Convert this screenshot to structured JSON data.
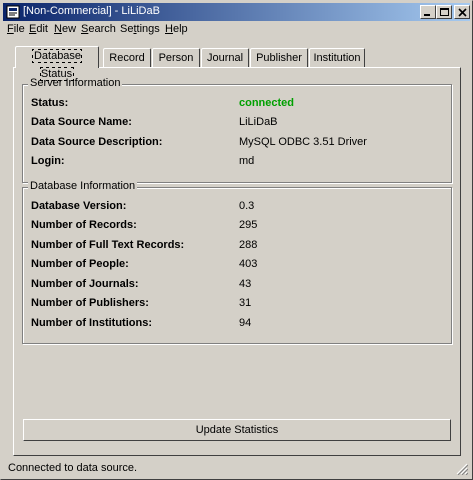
{
  "window": {
    "title": "[Non-Commercial] - LiLiDaB"
  },
  "menu": [
    "File",
    "Edit",
    "New",
    "Search",
    "Settings",
    "Help"
  ],
  "menu_underline": [
    "F",
    "E",
    "N",
    "S",
    "t",
    "H"
  ],
  "tabs": [
    {
      "label": "Database Status",
      "active": true
    },
    {
      "label": "Record",
      "active": false
    },
    {
      "label": "Person",
      "active": false
    },
    {
      "label": "Journal",
      "active": false
    },
    {
      "label": "Publisher",
      "active": false
    },
    {
      "label": "Institution",
      "active": false
    }
  ],
  "server_info": {
    "legend": "Server Information",
    "rows": [
      {
        "label": "Status:",
        "value": "connected"
      },
      {
        "label": "Data Source Name:",
        "value": "LiLiDaB"
      },
      {
        "label": "Data Source Description:",
        "value": "MySQL ODBC 3.51 Driver"
      },
      {
        "label": "Login:",
        "value": "md"
      }
    ]
  },
  "db_info": {
    "legend": "Database Information",
    "rows": [
      {
        "label": "Database Version:",
        "value": "0.3"
      },
      {
        "label": "Number of Records:",
        "value": "295"
      },
      {
        "label": "Number of Full Text Records:",
        "value": "288"
      },
      {
        "label": "Number of People:",
        "value": "403"
      },
      {
        "label": "Number of Journals:",
        "value": "43"
      },
      {
        "label": "Number of Publishers:",
        "value": "31"
      },
      {
        "label": "Number of Institutions:",
        "value": "94"
      }
    ]
  },
  "update_button": "Update Statistics",
  "status_bar": "Connected to data source.",
  "colors": {
    "title_start": "#0a246a",
    "title_end": "#a6caf0",
    "connected": "#00a000",
    "face": "#d4d0c8"
  }
}
